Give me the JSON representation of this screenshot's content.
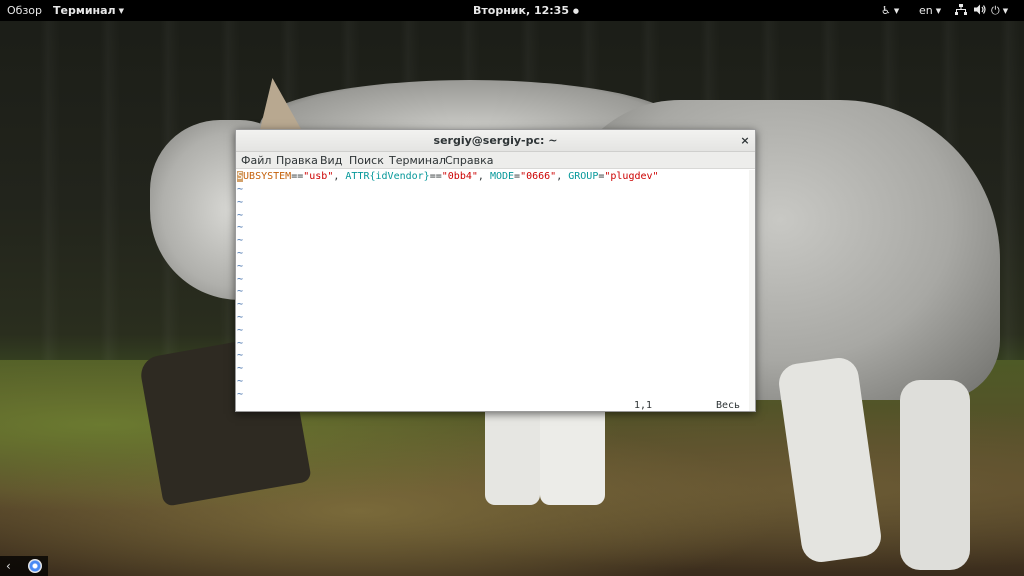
{
  "topbar": {
    "activities": "Обзор",
    "app_menu": "Терминал",
    "clock": "Вторник, 12:35",
    "language": "en",
    "icons": [
      "accessibility-icon",
      "network-icon",
      "volume-icon",
      "power-icon"
    ]
  },
  "window": {
    "title": "sergiy@sergiy-pc: ~",
    "close_glyph": "×",
    "menu": [
      "Файл",
      "Правка",
      "Вид",
      "Поиск",
      "Терминал",
      "Справка"
    ]
  },
  "terminal": {
    "content": {
      "cursor_char": "S",
      "k1": "UBSYSTEM",
      "op1": "==",
      "v1": "\"usb\"",
      "sep1": ", ",
      "k2a": "ATTR",
      "k2b": "{idVendor}",
      "op2": "==",
      "v2": "\"0bb4\"",
      "sep2": ", ",
      "k3": "MODE",
      "op3": "=",
      "v3": "\"0666\"",
      "sep3": ", ",
      "k4": "GROUP",
      "op4": "=",
      "v4": "\"plugdev\""
    },
    "tilde": "~",
    "tilde_count": 17,
    "status_position": "1,1",
    "status_scroll": "Весь"
  },
  "dock": {
    "back_glyph": "‹",
    "items": [
      "back-arrow-icon",
      "chrome-icon"
    ]
  },
  "colors": {
    "cursor": "#d3a16a",
    "keyword": "#c4600a",
    "identifier": "#06989a",
    "string": "#cc0000",
    "tilde": "#3465a4"
  }
}
